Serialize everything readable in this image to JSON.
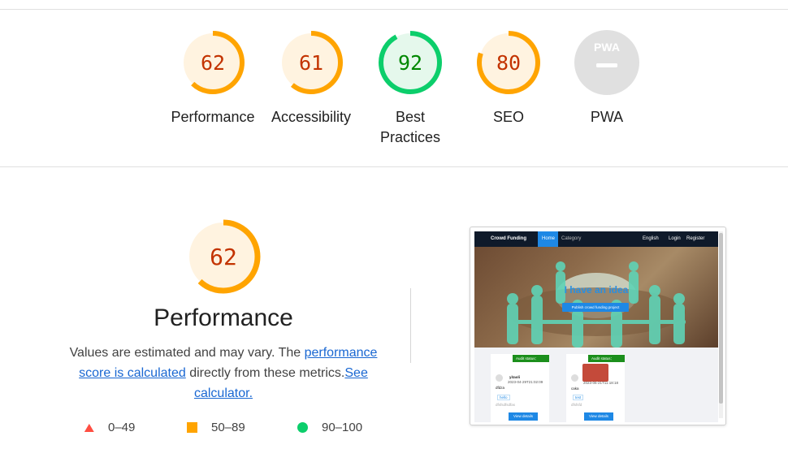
{
  "colors": {
    "average": "#ffa400",
    "average_bg": "#fff3e0",
    "average_text": "#c33300",
    "pass": "#0cce6b",
    "pass_bg": "#e5f8ec",
    "pass_text": "#008800",
    "pwa": "#e0e0e0",
    "fail": "#ff4e42"
  },
  "categories": [
    {
      "score": "62",
      "label": "Performance",
      "value": 0.62,
      "rating": "average"
    },
    {
      "score": "61",
      "label": "Accessibility",
      "value": 0.61,
      "rating": "average"
    },
    {
      "score": "92",
      "label": "Best Practices",
      "value": 0.92,
      "rating": "pass"
    },
    {
      "score": "80",
      "label": "SEO",
      "value": 0.8,
      "rating": "average"
    },
    {
      "score": "",
      "label": "PWA",
      "badge_text": "PWA",
      "rating": "na"
    }
  ],
  "performance": {
    "score": "62",
    "value": 0.62,
    "title": "Performance",
    "desc_before": "Values are estimated and may vary. The ",
    "link1": "performance score is calculated",
    "desc_middle": " directly from these metrics.",
    "link2": "See calculator."
  },
  "legend": [
    {
      "range": "0–49",
      "icon": "triangle-icon"
    },
    {
      "range": "50–89",
      "icon": "square-icon"
    },
    {
      "range": "90–100",
      "icon": "circle-icon"
    }
  ],
  "screenshot": {
    "brand": "Crowd Funding",
    "nav_home": "Home",
    "nav_category": "Category",
    "nav_english": "English",
    "nav_login": "Login",
    "nav_register": "Register",
    "hero_title": "I have an idea",
    "hero_button": "Publish crowd funding project",
    "cards": [
      {
        "status": "Audit status： Passed",
        "user": "yitaoli",
        "date": "2023-04-29T21:02:09",
        "title": "dfdza",
        "tag": "hello",
        "desc": "dfsfsdfsdfas",
        "button": "View details"
      },
      {
        "status": "Audit status： Passed",
        "user": "",
        "date": "2023-06-21T11:18:18",
        "title": "caka",
        "tag": "test",
        "desc": "dfsfsfd",
        "button": "View details"
      }
    ]
  }
}
